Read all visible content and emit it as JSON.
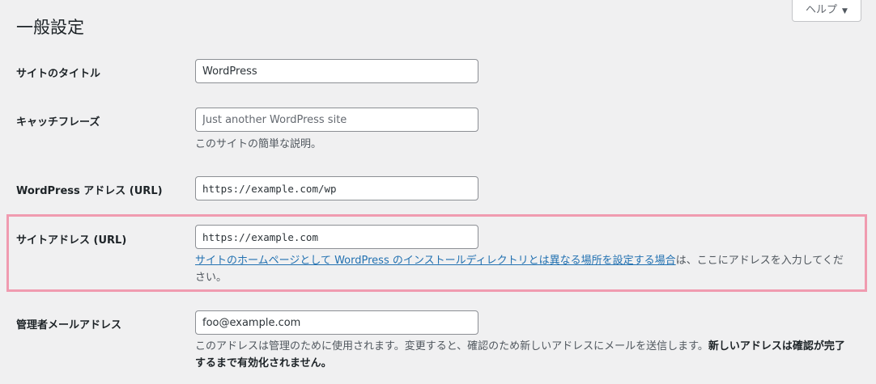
{
  "header": {
    "title": "一般設定",
    "help_label": "ヘルプ",
    "help_caret": "▼"
  },
  "settings": {
    "site_title": {
      "label": "サイトのタイトル",
      "value": "WordPress"
    },
    "tagline": {
      "label": "キャッチフレーズ",
      "placeholder": "Just another WordPress site",
      "value": "",
      "description": "このサイトの簡単な説明。"
    },
    "wp_address": {
      "label": "WordPress アドレス (URL)",
      "value": "https://example.com/wp"
    },
    "site_address": {
      "label": "サイトアドレス (URL)",
      "value": "https://example.com",
      "description_link": "サイトのホームページとして WordPress のインストールディレクトリとは異なる場所を設定する場合",
      "description_rest": "は、ここにアドレスを入力してください。"
    },
    "admin_email": {
      "label": "管理者メールアドレス",
      "value": "foo@example.com",
      "description": "このアドレスは管理のために使用されます。変更すると、確認のため新しいアドレスにメールを送信します。",
      "description_bold": "新しいアドレスは確認が完了するまで有効化されません。"
    }
  },
  "colors": {
    "highlight": "#f09bb0",
    "link": "#2271b1",
    "background": "#f0f0f1"
  }
}
